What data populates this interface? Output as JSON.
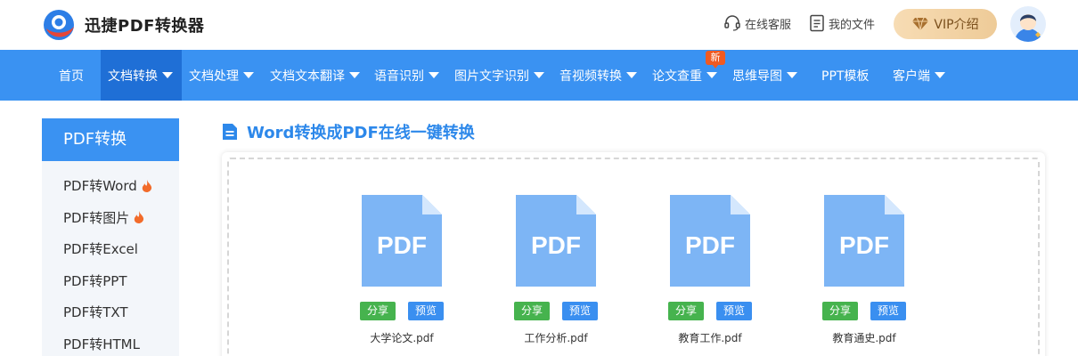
{
  "header": {
    "brand": "迅捷PDF转换器",
    "service_label": "在线客服",
    "files_label": "我的文件",
    "vip_label": "VIP介绍"
  },
  "nav": {
    "items": [
      {
        "label": "首页",
        "dropdown": false,
        "active": false
      },
      {
        "label": "文档转换",
        "dropdown": true,
        "active": true
      },
      {
        "label": "文档处理",
        "dropdown": true,
        "active": false
      },
      {
        "label": "文档文本翻译",
        "dropdown": true,
        "active": false
      },
      {
        "label": "语音识别",
        "dropdown": true,
        "active": false
      },
      {
        "label": "图片文字识别",
        "dropdown": true,
        "active": false
      },
      {
        "label": "音视频转换",
        "dropdown": true,
        "active": false
      },
      {
        "label": "论文查重",
        "dropdown": true,
        "active": false
      },
      {
        "label": "思维导图",
        "dropdown": true,
        "active": false
      },
      {
        "label": "PPT模板",
        "dropdown": false,
        "active": false
      },
      {
        "label": "客户端",
        "dropdown": true,
        "active": false
      }
    ],
    "new_badge": "新"
  },
  "sidebar": {
    "heading": "PDF转换",
    "items": [
      {
        "label": "PDF转Word",
        "hot": true
      },
      {
        "label": "PDF转图片",
        "hot": true
      },
      {
        "label": "PDF转Excel",
        "hot": false
      },
      {
        "label": "PDF转PPT",
        "hot": false
      },
      {
        "label": "PDF转TXT",
        "hot": false
      },
      {
        "label": "PDF转HTML",
        "hot": false
      }
    ]
  },
  "main": {
    "title": "Word转换成PDF在线一键转换",
    "files": [
      {
        "icon_text": "PDF",
        "share": "分享",
        "preview": "预览",
        "name": "大学论文.pdf"
      },
      {
        "icon_text": "PDF",
        "share": "分享",
        "preview": "预览",
        "name": "工作分析.pdf"
      },
      {
        "icon_text": "PDF",
        "share": "分享",
        "preview": "预览",
        "name": "教育工作.pdf"
      },
      {
        "icon_text": "PDF",
        "share": "分享",
        "preview": "预览",
        "name": "教育通史.pdf"
      }
    ]
  },
  "colors": {
    "primary": "#3a92f2",
    "nav_active": "#1f6fd6",
    "share": "#46b34e",
    "preview": "#3a8ff0",
    "pdf_icon": "#7db5f5",
    "badge": "#f05a22"
  }
}
